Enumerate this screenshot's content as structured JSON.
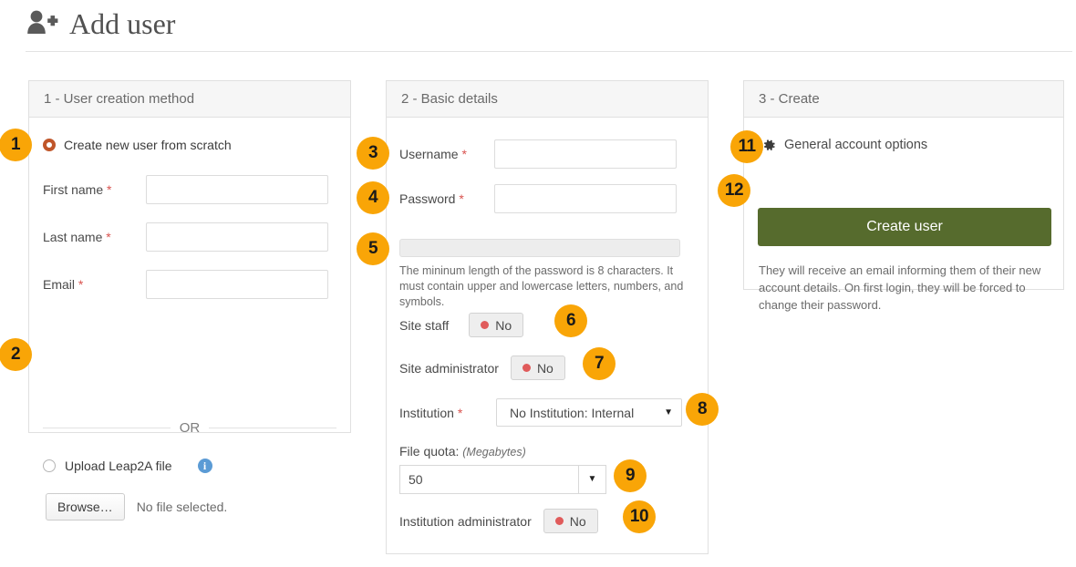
{
  "header": {
    "title": "Add user",
    "icon": "user-plus-icon"
  },
  "panels": {
    "creation_method": {
      "heading": "1 - User creation method",
      "radio_scratch": {
        "label": "Create new user from scratch",
        "selected": true
      },
      "fields": [
        {
          "label": "First name",
          "required_mark": "*",
          "value": ""
        },
        {
          "label": "Last name",
          "required_mark": "*",
          "value": ""
        },
        {
          "label": "Email",
          "required_mark": "*",
          "value": ""
        }
      ],
      "or_label": "OR",
      "radio_upload": {
        "label": "Upload Leap2A file",
        "selected": false
      },
      "info_icon_glyph": "i",
      "browse_button": "Browse…",
      "file_status": "No file selected."
    },
    "basic_details": {
      "heading": "2 - Basic details",
      "username": {
        "label": "Username",
        "required_mark": "*",
        "value": ""
      },
      "password": {
        "label": "Password",
        "required_mark": "*",
        "value": ""
      },
      "strength_help": "The mininum length of the password is 8 characters. It must contain upper and lowercase letters, numbers, and symbols.",
      "site_staff": {
        "label": "Site staff",
        "value": "No"
      },
      "site_administrator": {
        "label": "Site administrator",
        "value": "No"
      },
      "institution": {
        "label": "Institution",
        "required_mark": "*",
        "value": "No Institution: Internal",
        "caret": "▼"
      },
      "file_quota": {
        "label": "File quota:",
        "unit": "(Megabytes)",
        "value": "50",
        "caret": "▼"
      },
      "institution_administrator": {
        "label": "Institution administrator",
        "value": "No"
      }
    },
    "create": {
      "heading": "3 - Create",
      "general_account_options": "General account options",
      "create_button": "Create user",
      "note": "They will receive an email informing them of their new account details. On first login, they will be forced to change their password."
    }
  },
  "callouts": [
    {
      "n": "1"
    },
    {
      "n": "2"
    },
    {
      "n": "3"
    },
    {
      "n": "4"
    },
    {
      "n": "5"
    },
    {
      "n": "6"
    },
    {
      "n": "7"
    },
    {
      "n": "8"
    },
    {
      "n": "9"
    },
    {
      "n": "10"
    },
    {
      "n": "11"
    },
    {
      "n": "12"
    }
  ],
  "colors": {
    "badge": "#f9a507",
    "create_button": "#566b2d",
    "required": "#d9534f",
    "switch_dot": "#e05b5b",
    "info": "#5b9bd5",
    "radio_selected": "#c0562a"
  }
}
